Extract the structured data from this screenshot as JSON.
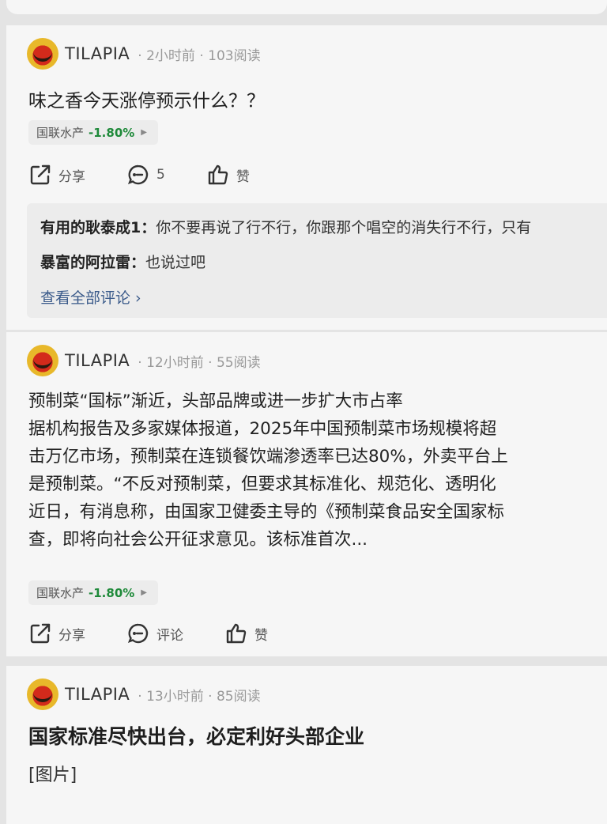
{
  "posts": [
    {
      "user": "TILAPIA",
      "meta": "· 2小时前 · 103阅读",
      "title": "味之香今天涨停预示什么？？",
      "tag": {
        "name": "国联水产",
        "pct": "-1.80%"
      },
      "actions": {
        "share": "分享",
        "comment": "5",
        "like": "赞"
      },
      "comments": [
        {
          "who": "有用的耿泰成1：",
          "text": "你不要再说了行不行，你跟那个唱空的消失行不行，只有"
        },
        {
          "who": "暴富的阿拉雷：",
          "text": "也说过吧"
        }
      ],
      "view_all": "查看全部评论 ›"
    },
    {
      "user": "TILAPIA",
      "meta": "· 12小时前 · 55阅读",
      "lines": [
        "预制菜“国标”渐近，头部品牌或进一步扩大市占率",
        "据机构报告及多家媒体报道，2025年中国预制菜市场规模将超",
        "击万亿市场，预制菜在连锁餐饮端渗透率已达80%，外卖平台上",
        "是预制菜。“不反对预制菜，但要求其标准化、规范化、透明化",
        "近日，有消息称，由国家卫健委主导的《预制菜食品安全国家标",
        "查，即将向社会公开征求意见。该标准首次..."
      ],
      "tag": {
        "name": "国联水产",
        "pct": "-1.80%"
      },
      "actions": {
        "share": "分享",
        "comment": "评论",
        "like": "赞"
      }
    },
    {
      "user": "TILAPIA",
      "meta": "· 13小时前 · 85阅读",
      "title": "国家标准尽快出台，必定利好头部企业",
      "image_placeholder": "[图片]"
    }
  ]
}
